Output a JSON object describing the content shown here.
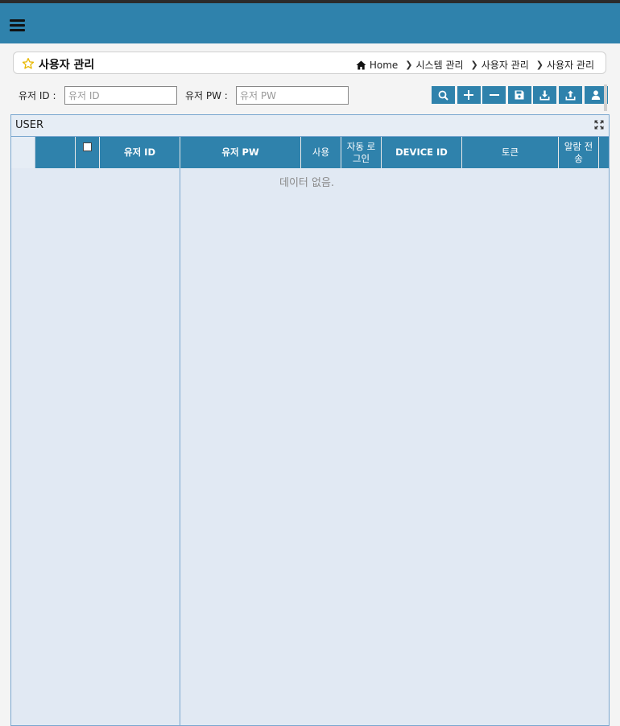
{
  "header": {
    "menu_icon": "hamburger-menu-icon"
  },
  "title_bar": {
    "title": "사용자 관리",
    "star_icon": "star-icon",
    "breadcrumb": {
      "home": "Home",
      "items": [
        "시스템 관리",
        "사용자 관리",
        "사용자 관리"
      ]
    }
  },
  "search": {
    "user_id_label": "유저 ID :",
    "user_id_placeholder": "유저 ID",
    "user_id_value": "",
    "user_pw_label": "유저 PW :",
    "user_pw_placeholder": "유저 PW",
    "user_pw_value": ""
  },
  "toolbar": [
    "search-icon",
    "plus-icon",
    "minus-icon",
    "save-icon",
    "download-icon",
    "upload-icon",
    "user-icon"
  ],
  "grid": {
    "caption": "USER",
    "columns": [
      "유저 ID",
      "유저 PW",
      "사용",
      "자동 로그인",
      "DEVICE ID",
      "토큰",
      "알람 전송"
    ],
    "empty_message": "데이터 없음.",
    "rows": []
  },
  "colors": {
    "accent": "#2f82ac",
    "grid_bg": "#e1e9f3",
    "border": "#7aa7cf"
  }
}
